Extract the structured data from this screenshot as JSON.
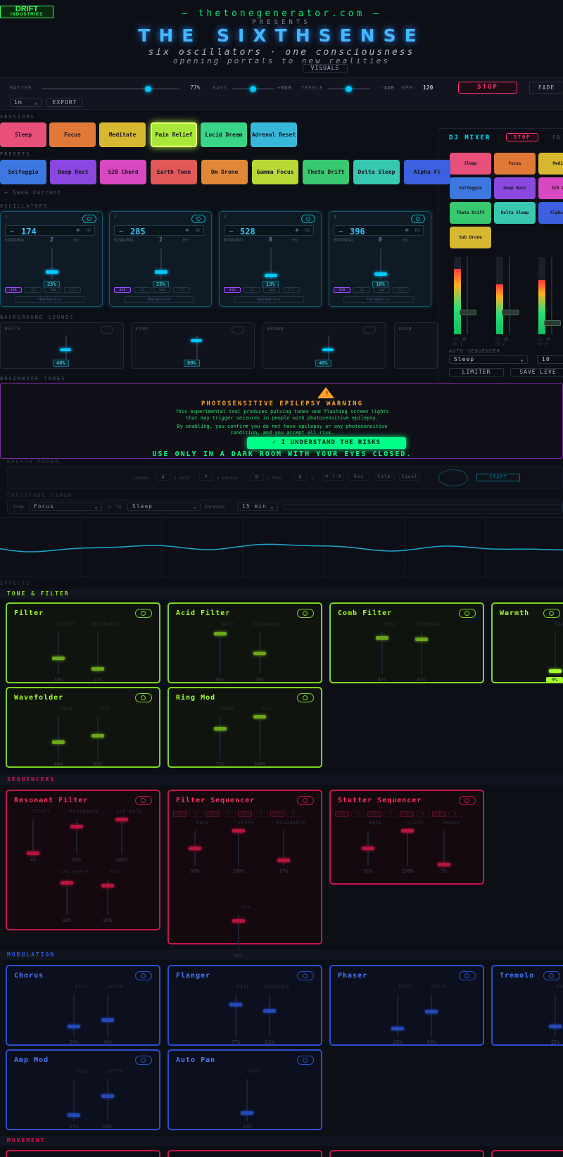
{
  "header": {
    "logo_line1": "DRIFT",
    "logo_line2": "INDUSTRIES",
    "site": "— thetonegenerator.com —",
    "presents": "PRESENTS",
    "title": "THE SIXTHSENSE",
    "subtitle": "six oscillators · one consciousness",
    "tagline": "opening portals to new realities",
    "visuals_button": "VISUALS"
  },
  "master_bar": {
    "master_label": "MASTER",
    "master_value": "77%",
    "master_level": 0.77,
    "bass_label": "BASS",
    "bass_value": "+0dB",
    "treble_label": "TREBLE",
    "treble_value": "-4dB",
    "bpm_label": "BPM",
    "bpm_value": "120",
    "stop_button": "STOP",
    "fade_button": "FADE",
    "duration_select": "1m",
    "export_button": "EXPORT"
  },
  "sessions": {
    "label": "SESSIONS",
    "items": [
      "Sleep",
      "Focus",
      "Meditate",
      "Pain Relief",
      "Lucid Dream",
      "Adrenal Reset"
    ],
    "colors": [
      "#e8507a",
      "#e07838",
      "#d8b830",
      "#a8e838",
      "#38d488",
      "#38b8d8"
    ]
  },
  "presets": {
    "label": "PRESETS",
    "items": [
      "Solfeggio",
      "Deep Rest",
      "528 Chord",
      "Earth Tone",
      "Om Drone",
      "Gamma Focus",
      "Theta Drift",
      "Delta Sleep",
      "Alpha Fl"
    ],
    "colors": [
      "#3c78e0",
      "#8a48e0",
      "#d848c0",
      "#e05858",
      "#e08838",
      "#b8d838",
      "#38c870",
      "#38c8b0",
      "#3c60e0"
    ],
    "save_label": "+ Save Current"
  },
  "oscillators": {
    "label": "OSCILLATORS",
    "items": [
      {
        "num": "1",
        "freq": "174",
        "binaural": "2",
        "level": "25%",
        "level_frac": 0.25
      },
      {
        "num": "2",
        "freq": "285",
        "binaural": "2",
        "level": "25%",
        "level_frac": 0.25
      },
      {
        "num": "3",
        "freq": "528",
        "binaural": "0",
        "level": "13%",
        "level_frac": 0.13
      },
      {
        "num": "4",
        "freq": "396",
        "binaural": "0",
        "level": "18%",
        "level_frac": 0.18
      }
    ],
    "binaural_label": "BINAURAL",
    "unit": "Hz",
    "waves": [
      "sin",
      "sq",
      "saw",
      "tri"
    ],
    "harmonics_label": "Harmonics"
  },
  "background": {
    "label": "BACKGROUND SOUNDS",
    "items": [
      {
        "name": "WHITE",
        "value": "40%",
        "frac": 0.4
      },
      {
        "name": "PINK",
        "value": "80%",
        "frac": 0.8
      },
      {
        "name": "BROWN",
        "value": "40%",
        "frac": 0.4
      },
      {
        "name": "RAIN",
        "value": "",
        "frac": 0
      }
    ]
  },
  "brainwave_label": "BRAINWAVE TONES",
  "warning": {
    "title": "PHOTOSENSITIVE EPILEPSY WARNING",
    "line1": "This experimental tool produces pulsing tones and flashing screen lights",
    "line2": "that may trigger seizures in people with photosensitive epilepsy.",
    "line3": "By enabling, you confirm you do not have epilepsy or any photosensitive",
    "line4": "condition, and you accept all risk.",
    "accept_button": "✓ I UNDERSTAND THE RISKS",
    "footer": "USE ONLY IN A DARK ROOM WITH YOUR EYES CLOSED."
  },
  "breath": {
    "label": "BREATH PACER",
    "inhale_label": "Inhale",
    "inhale": "4",
    "hold_label": "s Hold",
    "hold": "7",
    "exhale_label": "s Exhale",
    "exhale": "8",
    "rest_label": "s Rest",
    "rest": "0",
    "s_label": "s",
    "patterns": [
      "4-7-8",
      "Box",
      "Calm",
      "Equal"
    ],
    "start_button": "START"
  },
  "crossfade": {
    "label": "CROSSFADE TIMER",
    "from_label": "From",
    "from": "Focus",
    "to_label": "To",
    "to": "Sleep",
    "duration_label": "Duration",
    "duration": "15 min"
  },
  "effects_label": "EFFECTS",
  "tone_filter": {
    "label": "TONE & FILTER",
    "panels": [
      {
        "title": "Filter",
        "params": [
          {
            "name": "CUTOFF",
            "value": "38%",
            "frac": 0.38
          },
          {
            "name": "RESONANCE",
            "value": "13%",
            "frac": 0.13
          }
        ]
      },
      {
        "title": "Acid Filter",
        "params": [
          {
            "name": "RATE",
            "value": "96%",
            "frac": 0.96
          },
          {
            "name": "RESONANCE",
            "value": "50%",
            "frac": 0.5
          }
        ]
      },
      {
        "title": "Comb Filter",
        "params": [
          {
            "name": "FREQ",
            "value": "87%",
            "frac": 0.87
          },
          {
            "name": "FEEDBACK",
            "value": "83%",
            "frac": 0.83
          }
        ]
      },
      {
        "title": "Warmth",
        "params": [
          {
            "name": "DRIVE",
            "value": "9%",
            "frac": 0.09
          }
        ]
      },
      {
        "title": "Wavefolder",
        "params": [
          {
            "name": "FOLD",
            "value": "40%",
            "frac": 0.4
          },
          {
            "name": "MIX",
            "value": "55%",
            "frac": 0.55
          }
        ]
      },
      {
        "title": "Ring Mod",
        "params": [
          {
            "name": "FREQ",
            "value": "71%",
            "frac": 0.71
          },
          {
            "name": "MIX",
            "value": "100%",
            "frac": 1.0
          }
        ]
      }
    ]
  },
  "sequencers": {
    "label": "SEQUENCERS",
    "steps": [
      "1",
      "2",
      "3",
      "4",
      "5",
      "6",
      "7",
      "8"
    ],
    "panels": [
      {
        "title": "Resonant Filter",
        "params": [
          {
            "name": "CUTOFF",
            "value": "4%",
            "frac": 0.04
          },
          {
            "name": "RESONANCE",
            "value": "81%",
            "frac": 0.81
          },
          {
            "name": "LFO RATE",
            "value": "100%",
            "frac": 1.0
          },
          {
            "name": "LFO DEPTH",
            "value": "93%",
            "frac": 0.93
          },
          {
            "name": "MIX",
            "value": "85%",
            "frac": 0.85
          }
        ]
      },
      {
        "title": "Filter Sequencer",
        "params": [
          {
            "name": "RATE",
            "value": "50%",
            "frac": 0.5
          },
          {
            "name": "STEPS",
            "value": "100%",
            "frac": 1.0
          },
          {
            "name": "RESONANCE",
            "value": "17%",
            "frac": 0.17
          },
          {
            "name": "MIX",
            "value": "85%",
            "frac": 0.85
          }
        ]
      },
      {
        "title": "Stutter Sequencer",
        "params": [
          {
            "name": "RATE",
            "value": "50%",
            "frac": 0.5
          },
          {
            "name": "STEPS",
            "value": "100%",
            "frac": 1.0
          },
          {
            "name": "SNAPS",
            "value": "5%",
            "frac": 0.05
          }
        ]
      }
    ]
  },
  "modulation": {
    "label": "MODULATION",
    "panels": [
      {
        "title": "Chorus",
        "params": [
          {
            "name": "RATE",
            "value": "25%",
            "frac": 0.25
          },
          {
            "name": "DEPTH",
            "value": "40%",
            "frac": 0.4
          }
        ]
      },
      {
        "title": "Flanger",
        "params": [
          {
            "name": "RATE",
            "value": "77%",
            "frac": 0.77
          },
          {
            "name": "FEEDBACK",
            "value": "62%",
            "frac": 0.62
          }
        ]
      },
      {
        "title": "Phaser",
        "params": [
          {
            "name": "RATE",
            "value": "20%",
            "frac": 0.2
          },
          {
            "name": "DEPTH",
            "value": "60%",
            "frac": 0.6
          }
        ]
      },
      {
        "title": "Tremolo",
        "params": [
          {
            "name": "RATE",
            "value": "25%",
            "frac": 0.25
          }
        ]
      },
      {
        "title": "Amp Mod",
        "params": [
          {
            "name": "FREQ",
            "value": "15%",
            "frac": 0.15
          },
          {
            "name": "DEPTH",
            "value": "60%",
            "frac": 0.6
          }
        ]
      },
      {
        "title": "Auto Pan",
        "params": [
          {
            "name": "RATE",
            "value": "20%",
            "frac": 0.2
          }
        ]
      }
    ]
  },
  "movement_label": "MOVEMENT",
  "dj_mixer": {
    "title": "DJ MIXER",
    "stop_button": "STOP",
    "fade_button": "FA",
    "pads": [
      "Sleep",
      "Focus",
      "Medit",
      "Solfeggio",
      "Deep Rest",
      "528 Ch",
      "Theta Drift",
      "Delta Sleep",
      "Alpha F",
      "Sub Drone"
    ],
    "pad_colors": [
      "#e8507a",
      "#e07838",
      "#d8b830",
      "#3c78e0",
      "#8a48e0",
      "#d848c0",
      "#38c870",
      "#38c8b0",
      "#3c60e0",
      "#d8b830"
    ],
    "channels": [
      {
        "db": "-17 dB",
        "name": "CH 1",
        "meter": 0.85,
        "fader": 0.28
      },
      {
        "db": "-22 dB",
        "name": "CH 2",
        "meter": 0.65,
        "fader": 0.28
      },
      {
        "db": "-21 dB",
        "name": "CH 3",
        "meter": 0.7,
        "fader": 0.15
      }
    ],
    "auto_seq_label": "AUTO SEQUENCER",
    "auto_seq_value": "Sleep",
    "auto_seq_count": "10",
    "limiter_button": "LIMITER",
    "save_levels_button": "SAVE LEVE"
  }
}
